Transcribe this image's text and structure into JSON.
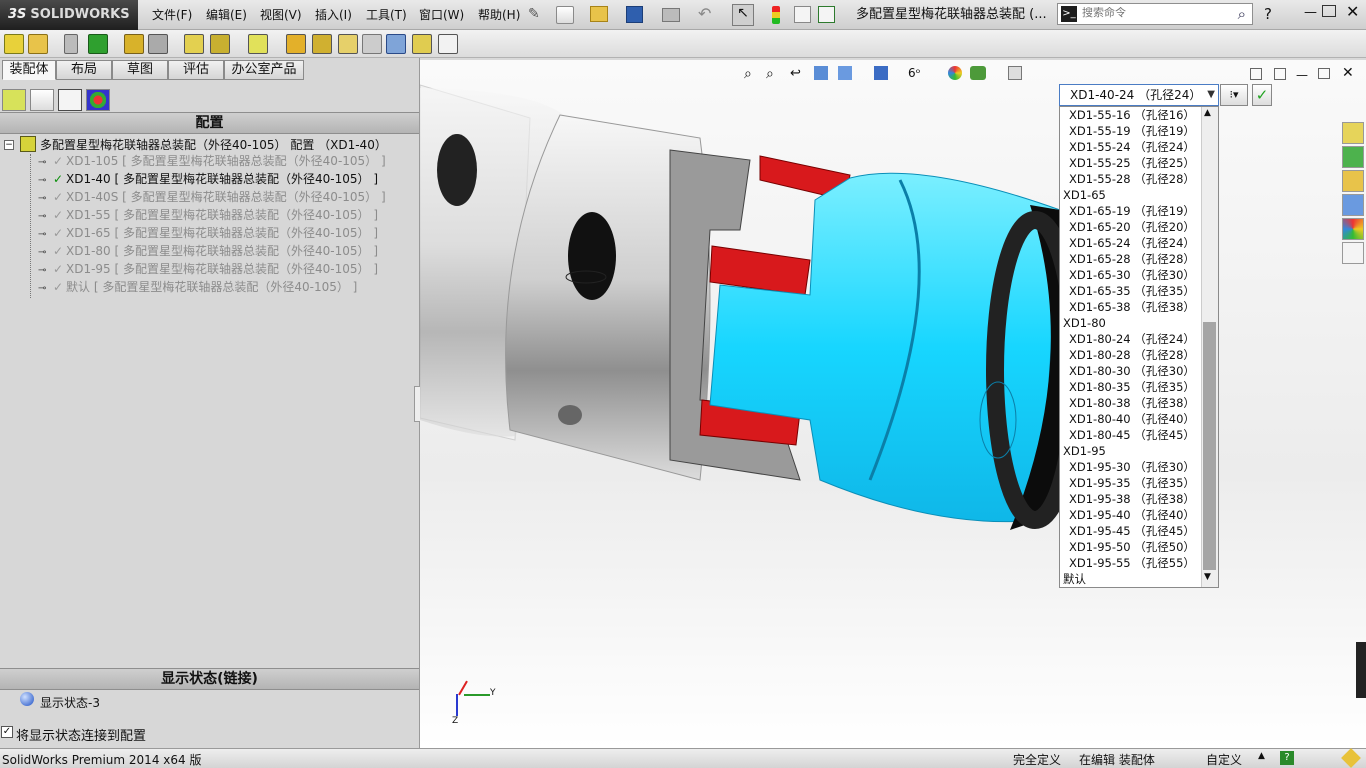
{
  "app": {
    "logo_brand": "3S",
    "logo_name": "SOLIDWORKS"
  },
  "menu": [
    {
      "label": "文件(F)"
    },
    {
      "label": "编辑(E)"
    },
    {
      "label": "视图(V)"
    },
    {
      "label": "插入(I)"
    },
    {
      "label": "工具(T)"
    },
    {
      "label": "窗口(W)"
    },
    {
      "label": "帮助(H)"
    }
  ],
  "document_title": "多配置星型梅花联轴器总装配 (...",
  "search": {
    "placeholder": "搜索命令"
  },
  "help_symbol": "?",
  "tabs": [
    {
      "label": "装配体",
      "active": true
    },
    {
      "label": "布局"
    },
    {
      "label": "草图"
    },
    {
      "label": "评估"
    },
    {
      "label": "办公室产品"
    }
  ],
  "config_panel": {
    "header": "配置",
    "root": "多配置星型梅花联轴器总装配（外径40-105） 配置 （XD1-40）",
    "items": [
      {
        "name": "XD1-105",
        "assembly": "[ 多配置星型梅花联轴器总装配（外径40-105） ]",
        "active": false
      },
      {
        "name": "XD1-40",
        "assembly": "[ 多配置星型梅花联轴器总装配（外径40-105） ]",
        "active": true
      },
      {
        "name": "XD1-40S",
        "assembly": "[ 多配置星型梅花联轴器总装配（外径40-105） ]",
        "active": false
      },
      {
        "name": "XD1-55",
        "assembly": "[ 多配置星型梅花联轴器总装配（外径40-105） ]",
        "active": false
      },
      {
        "name": "XD1-65",
        "assembly": "[ 多配置星型梅花联轴器总装配（外径40-105） ]",
        "active": false
      },
      {
        "name": "XD1-80",
        "assembly": "[ 多配置星型梅花联轴器总装配（外径40-105） ]",
        "active": false
      },
      {
        "name": "XD1-95",
        "assembly": "[ 多配置星型梅花联轴器总装配（外径40-105） ]",
        "active": false
      },
      {
        "name": "默认",
        "assembly": "[ 多配置星型梅花联轴器总装配（外径40-105） ]",
        "active": false
      }
    ]
  },
  "display_state": {
    "header": "显示状态(链接)",
    "item": "显示状态-3",
    "link_checkbox_label": "将显示状态连接到配置",
    "link_checked": true
  },
  "config_dropdown": {
    "selected": "XD1-40-24 （孔径24）",
    "options": [
      "XD1-55-16 （孔径16）",
      "XD1-55-19 （孔径19）",
      "XD1-55-24 （孔径24）",
      "XD1-55-25 （孔径25）",
      "XD1-55-28 （孔径28）",
      "XD1-65",
      "XD1-65-19 （孔径19）",
      "XD1-65-20 （孔径20）",
      "XD1-65-24 （孔径24）",
      "XD1-65-28 （孔径28）",
      "XD1-65-30 （孔径30）",
      "XD1-65-35 （孔径35）",
      "XD1-65-38 （孔径38）",
      "XD1-80",
      "XD1-80-24 （孔径24）",
      "XD1-80-28 （孔径28）",
      "XD1-80-30 （孔径30）",
      "XD1-80-35 （孔径35）",
      "XD1-80-38 （孔径38）",
      "XD1-80-40 （孔径40）",
      "XD1-80-45 （孔径45）",
      "XD1-95",
      "XD1-95-30 （孔径30）",
      "XD1-95-35 （孔径35）",
      "XD1-95-38 （孔径38）",
      "XD1-95-40 （孔径40）",
      "XD1-95-45 （孔径45）",
      "XD1-95-50 （孔径50）",
      "XD1-95-55 （孔径55）",
      "默认"
    ]
  },
  "triad": {
    "y_label": "Y",
    "z_label": "Z"
  },
  "status_bar": {
    "product": "SolidWorks Premium 2014 x64 版",
    "definition": "完全定义",
    "mode": "在编辑 装配体",
    "custom": "自定义"
  },
  "colors": {
    "coupling_blue": "#19d9ff",
    "spider_red": "#d8191c",
    "accept_green": "#22a322"
  }
}
